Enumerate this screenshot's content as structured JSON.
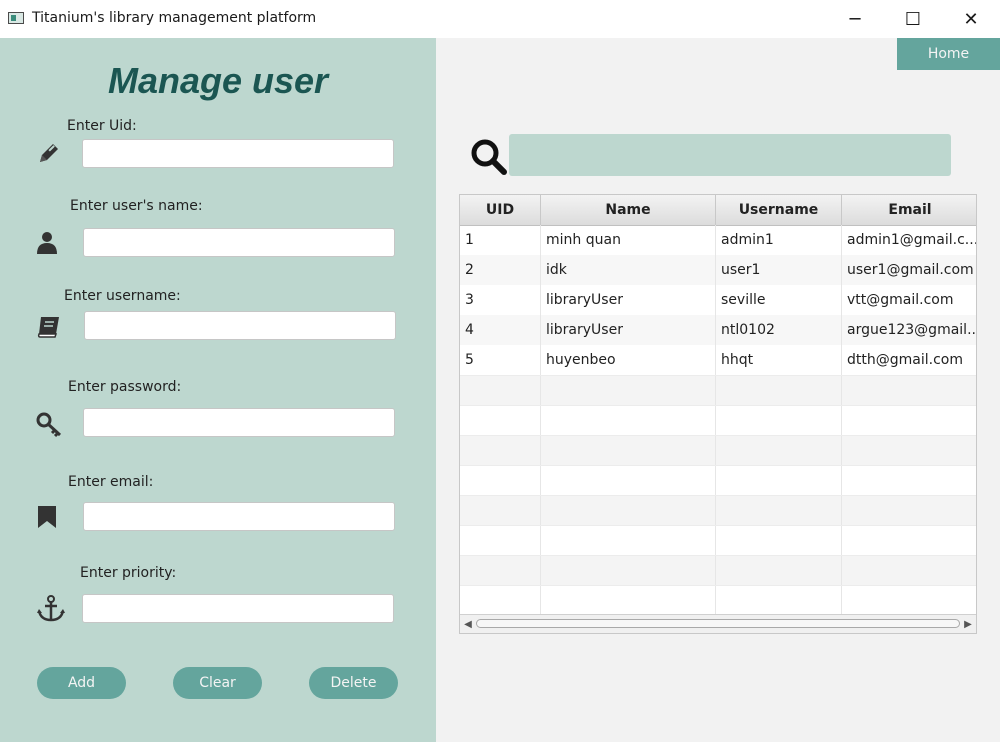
{
  "window": {
    "title": "Titanium's library management platform",
    "minimize": "─",
    "maximize": "☐",
    "close": "✕"
  },
  "form": {
    "heading": "Manage user",
    "fields": [
      {
        "label": "Enter Uid:",
        "icon": "pencil-icon",
        "value": ""
      },
      {
        "label": "Enter user's name:",
        "icon": "user-icon",
        "value": ""
      },
      {
        "label": "Enter username:",
        "icon": "book-icon",
        "value": ""
      },
      {
        "label": "Enter password:",
        "icon": "key-icon",
        "value": ""
      },
      {
        "label": "Enter email:",
        "icon": "bookmark-icon",
        "value": ""
      },
      {
        "label": "Enter priority:",
        "icon": "anchor-icon",
        "value": ""
      }
    ],
    "buttons": {
      "add": "Add",
      "clear": "Clear",
      "delete": "Delete"
    }
  },
  "nav": {
    "home": "Home"
  },
  "search": {
    "icon": "search-icon",
    "value": ""
  },
  "table": {
    "columns": [
      "UID",
      "Name",
      "Username",
      "Email"
    ],
    "rows": [
      {
        "uid": "1",
        "name": "minh quan",
        "username": "admin1",
        "email": "admin1@gmail.c..."
      },
      {
        "uid": "2",
        "name": "idk",
        "username": "user1",
        "email": "user1@gmail.com"
      },
      {
        "uid": "3",
        "name": "libraryUser",
        "username": "seville",
        "email": "vtt@gmail.com"
      },
      {
        "uid": "4",
        "name": "libraryUser",
        "username": "ntl0102",
        "email": "argue123@gmail..."
      },
      {
        "uid": "5",
        "name": "huyenbeo",
        "username": "hhqt",
        "email": "dtth@gmail.com"
      }
    ]
  },
  "colors": {
    "panel": "#bdd7cf",
    "accent": "#64a59d",
    "heading": "#1b5652"
  }
}
